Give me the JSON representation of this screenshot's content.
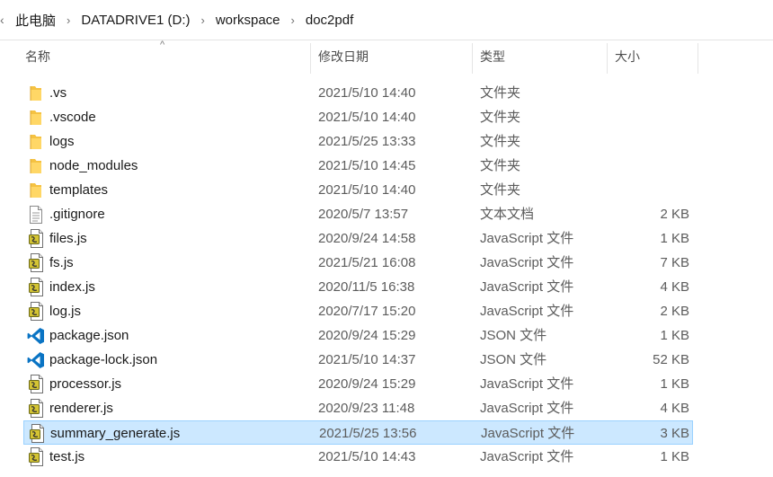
{
  "breadcrumb": {
    "segments": [
      "此电脑",
      "DATADRIVE1 (D:)",
      "workspace",
      "doc2pdf"
    ]
  },
  "columns": {
    "name": "名称",
    "date": "修改日期",
    "type": "类型",
    "size": "大小",
    "sort": "name-ascending"
  },
  "files": [
    {
      "name": ".vs",
      "date": "2021/5/10 14:40",
      "type": "文件夹",
      "size": "",
      "icon": "folder-icon"
    },
    {
      "name": ".vscode",
      "date": "2021/5/10 14:40",
      "type": "文件夹",
      "size": "",
      "icon": "folder-icon"
    },
    {
      "name": "logs",
      "date": "2021/5/25 13:33",
      "type": "文件夹",
      "size": "",
      "icon": "folder-icon"
    },
    {
      "name": "node_modules",
      "date": "2021/5/10 14:45",
      "type": "文件夹",
      "size": "",
      "icon": "folder-icon"
    },
    {
      "name": "templates",
      "date": "2021/5/10 14:40",
      "type": "文件夹",
      "size": "",
      "icon": "folder-icon"
    },
    {
      "name": ".gitignore",
      "date": "2020/5/7 13:57",
      "type": "文本文档",
      "size": "2 KB",
      "icon": "text-file-icon"
    },
    {
      "name": "files.js",
      "date": "2020/9/24 14:58",
      "type": "JavaScript 文件",
      "size": "1 KB",
      "icon": "js-file-icon"
    },
    {
      "name": "fs.js",
      "date": "2021/5/21 16:08",
      "type": "JavaScript 文件",
      "size": "7 KB",
      "icon": "js-file-icon"
    },
    {
      "name": "index.js",
      "date": "2020/11/5 16:38",
      "type": "JavaScript 文件",
      "size": "4 KB",
      "icon": "js-file-icon"
    },
    {
      "name": "log.js",
      "date": "2020/7/17 15:20",
      "type": "JavaScript 文件",
      "size": "2 KB",
      "icon": "js-file-icon"
    },
    {
      "name": "package.json",
      "date": "2020/9/24 15:29",
      "type": "JSON 文件",
      "size": "1 KB",
      "icon": "vscode-file-icon"
    },
    {
      "name": "package-lock.json",
      "date": "2021/5/10 14:37",
      "type": "JSON 文件",
      "size": "52 KB",
      "icon": "vscode-file-icon"
    },
    {
      "name": "processor.js",
      "date": "2020/9/24 15:29",
      "type": "JavaScript 文件",
      "size": "1 KB",
      "icon": "js-file-icon"
    },
    {
      "name": "renderer.js",
      "date": "2020/9/23 11:48",
      "type": "JavaScript 文件",
      "size": "4 KB",
      "icon": "js-file-icon"
    },
    {
      "name": "summary_generate.js",
      "date": "2021/5/25 13:56",
      "type": "JavaScript 文件",
      "size": "3 KB",
      "icon": "js-file-icon",
      "selected": true
    },
    {
      "name": "test.js",
      "date": "2021/5/10 14:43",
      "type": "JavaScript 文件",
      "size": "1 KB",
      "icon": "js-file-icon"
    }
  ],
  "colors": {
    "selection_bg": "#cce8ff",
    "selection_border": "#99d1ff",
    "folder": "#f5c242",
    "vscode_blue": "#0a74c4"
  }
}
